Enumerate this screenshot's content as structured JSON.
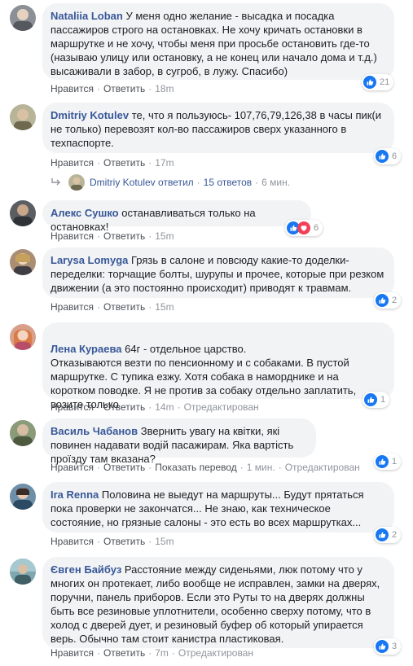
{
  "labels": {
    "like": "Нравится",
    "reply": "Ответить",
    "translate": "Показать перевод",
    "edited": "Отредактирован",
    "dot": "·"
  },
  "comments": [
    {
      "author": "Nataliia Loban",
      "text": "У меня одно желание - высадка и посадка пассажиров строго на остановках. Не хочу кричать остановки в маршрутке и не хочу, чтобы меня при просьбе остановить где-то (называю улицу или остановку, а не конец или начало дома и т.д.) высаживали в забор, в сугроб, в лужу. Спасибо)",
      "time": "18m",
      "reactions": "21"
    },
    {
      "author": "Dmitriy Kotulev",
      "text": "те, что я пользуюсь- 107,76,79,126,38 в часы пик(и не только) перевозят кол-во пассажиров сверх указанного в техпаспорте.",
      "time": "17m",
      "reactions": "6",
      "reply_summary": {
        "author": "Dmitriy Kotulev",
        "action": "ответил",
        "count": "15 ответов",
        "time": "6 мин."
      }
    },
    {
      "author": "Алекс Сушко",
      "text": "останавливаться только на остановках!",
      "time": "15m",
      "reactions": "6"
    },
    {
      "author": "Larysa Lomyga",
      "text": "Грязь в салоне и повсюду какие-то доделки-переделки: торчащие болты, шурупы и прочее, которые при резком движении (а это постоянно происходит) приводят к травмам.",
      "time": "15m",
      "reactions": "2"
    },
    {
      "author": "Лена Кураева",
      "text": "64г - отдельное царство.\nОтказываются везти по пенсионному и с собаками. В пустой маршрутке. С тупика езжу. Хотя собака в наморднике и на коротком поводке. Я не против за собаку отдельно заплатить, возите только",
      "time": "14m",
      "reactions": "1"
    },
    {
      "author": "Василь Чабанов",
      "text": "Звернить увагу на квітки, які повинен надавати водій пасажирам. Яка вартість проїзду там вказана?",
      "time": "1 мин.",
      "reactions": "1"
    },
    {
      "author": "Ira Renna",
      "text": "Половина не выедут на маршруты... Будут прятаться пока проверки не закончатся... Не знаю, как техническое состояние, но грязные салоны - это есть во всех маршрутках...",
      "time": "15m",
      "reactions": "2"
    },
    {
      "author": "Євген Байбуз",
      "text": "Расстояние между сиденьями, люк потому что у многих он протекает, либо вообще не исправлен, замки на дверях, поручни, панель приборов. Если это Руты то на дверях должны быть все резиновые уплотнители, особенно сверху потому, что в холод с дверей дует, и резиновый буфер об который упирается верь. Обычно там стоит канистра пластиковая.",
      "time": "7m",
      "reactions": "3"
    }
  ],
  "colors": {
    "like_blue": "#1877f2",
    "love_red": "#f33e58",
    "link": "#385898",
    "bubble": "#f2f3f5"
  }
}
